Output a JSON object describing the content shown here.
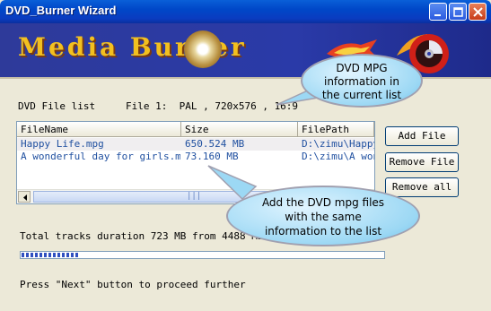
{
  "window": {
    "title": "DVD_Burner Wizard"
  },
  "banner": {
    "title": "Media Burner"
  },
  "dvd_file_list_label": "DVD File list",
  "file_info": "File 1:  PAL , 720x576 , 16:9",
  "list": {
    "columns": [
      "FileName",
      "Size",
      "FilePath"
    ],
    "rows": [
      {
        "name": "Happy Life.mpg",
        "size": "650.524 MB",
        "path": "D:\\zimu\\Happy"
      },
      {
        "name": "A wonderful day for girls.mpg",
        "size": "73.160 MB",
        "path": "D:\\zimu\\A wond"
      }
    ],
    "scroll_thumb_grip": "|||"
  },
  "buttons": {
    "add_file": "Add File",
    "remove_file": "Remove File",
    "remove_all": "Remove all"
  },
  "total": "Total tracks duration 723 MB from 4488 MB.",
  "progress": 0.16,
  "hint": "Press \"Next\" button to proceed further",
  "callouts": {
    "top": [
      "DVD MPG",
      "information in",
      "the current list"
    ],
    "bottom": [
      "Add the DVD mpg files",
      "with the same",
      "information to the list"
    ]
  },
  "colors": {
    "title_bar": "#0047c8",
    "banner": "#2a3aa8",
    "banner_text": "#f2c020",
    "list_text": "#2050a0",
    "callout": "#9cd8f4"
  }
}
